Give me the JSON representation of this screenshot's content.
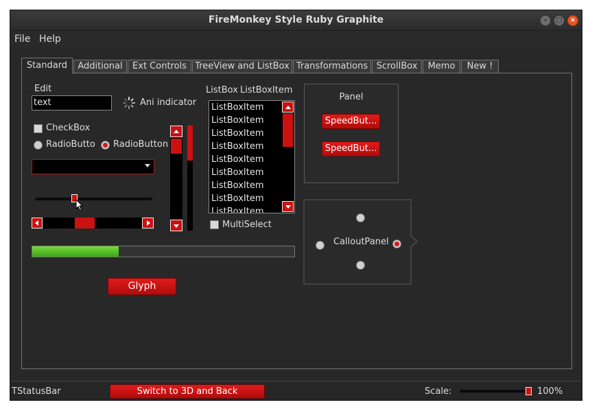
{
  "window": {
    "title": "FireMonkey Style Ruby Graphite"
  },
  "menu": {
    "file": "File",
    "help": "Help"
  },
  "tabs": [
    "Standard",
    "Additional",
    "Ext Controls",
    "TreeView and ListBox",
    "Transformations",
    "ScrollBox",
    "Memo",
    "New !"
  ],
  "standard": {
    "edit_label": "Edit",
    "edit_value": "text",
    "ani_indicator": "Ani indicator",
    "checkbox": "CheckBox",
    "radio1": "RadioButton",
    "radio2": "RadioButton",
    "combo_value": "",
    "listbox_label": "ListBox",
    "listboxitem_label": "ListBoxItem",
    "listbox_items": [
      "ListBoxItem",
      "ListBoxItem",
      "ListBoxItem",
      "ListBoxItem",
      "ListBoxItem",
      "ListBoxItem",
      "ListBoxItem",
      "ListBoxItem",
      "ListBoxItem"
    ],
    "multiselect": "MultiSelect",
    "panel_label": "Panel",
    "speed_button_1": "SpeedBut...",
    "speed_button_2": "SpeedBut...",
    "callout_label": "CalloutPanel",
    "glyph_button": "Glyph",
    "progress_fraction": 0.33
  },
  "statusbar": {
    "label": "TStatusBar",
    "switch_button": "Switch to 3D and Back",
    "scale_label": "Scale:",
    "scale_value": "100%"
  },
  "colors": {
    "accent": "#cc1111",
    "progress": "#4fc02a",
    "background": "#282828"
  }
}
